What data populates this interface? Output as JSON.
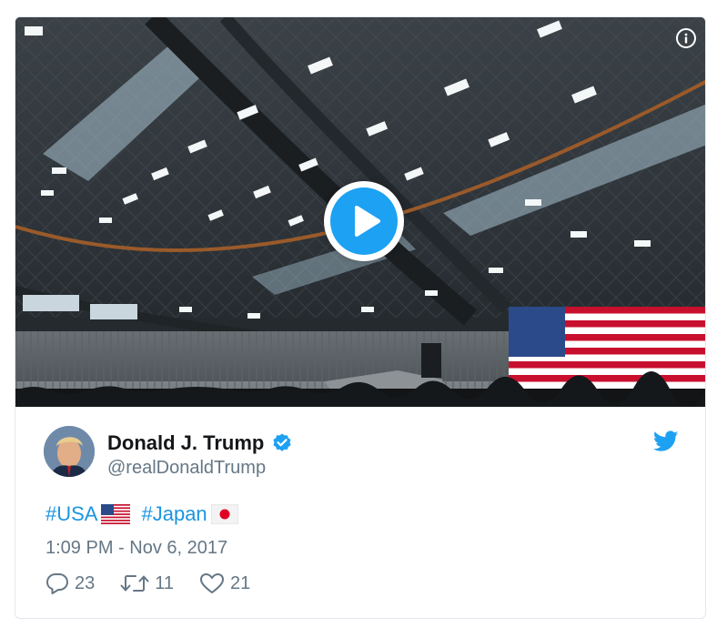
{
  "colors": {
    "accent": "#1da1f2",
    "link": "#1b95e0",
    "text": "#14171a",
    "muted": "#657786",
    "border": "#e1e8ed"
  },
  "media": {
    "info_icon": "info-icon",
    "play_icon": "play-icon"
  },
  "author": {
    "name": "Donald J. Trump",
    "handle": "@realDonaldTrump",
    "verified_icon": "verified-badge-icon",
    "avatar_icon": "avatar"
  },
  "platform_icon": "twitter-bird-icon",
  "tweet": {
    "hashtag_1": "#USA",
    "flag_1": "us-flag-emoji",
    "hashtag_2": "#Japan",
    "flag_2": "japan-flag-emoji",
    "timestamp": "1:09 PM - Nov 6, 2017"
  },
  "actions": {
    "replies": "23",
    "retweets": "11",
    "likes": "21"
  }
}
